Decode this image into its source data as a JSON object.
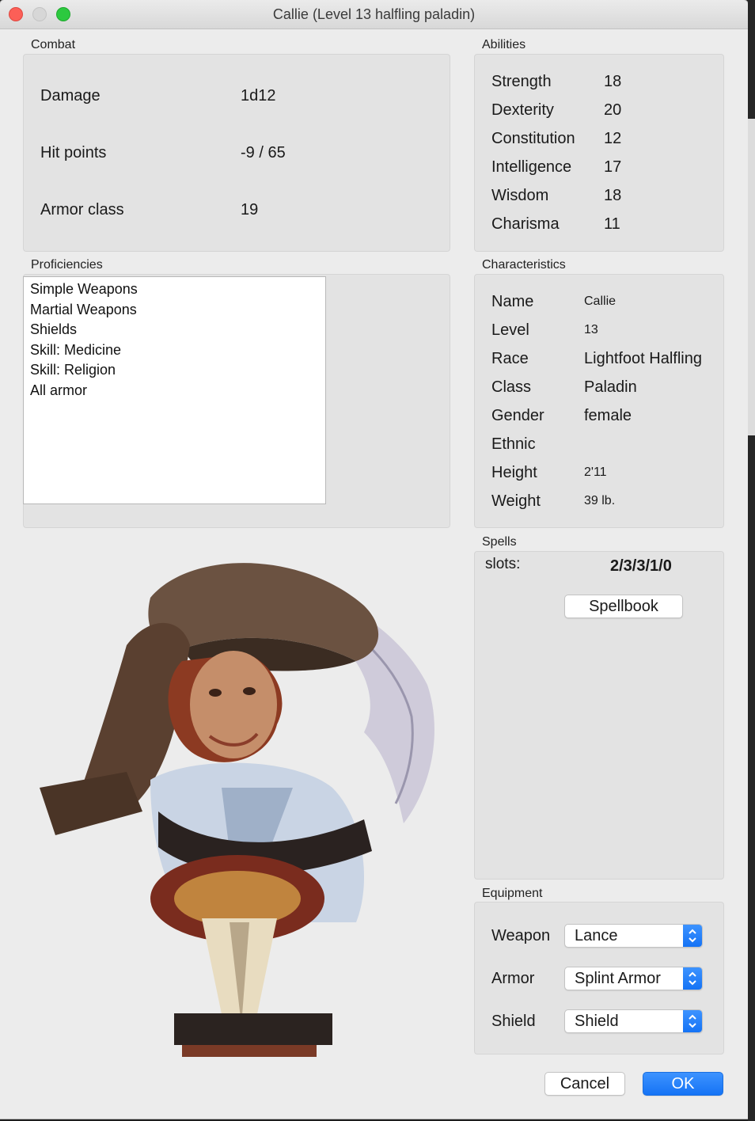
{
  "window": {
    "title": "Callie (Level 13 halfling paladin)"
  },
  "combat": {
    "label": "Combat",
    "rows": [
      {
        "label": "Damage",
        "value": "1d12"
      },
      {
        "label": "Hit points",
        "value": "-9 / 65"
      },
      {
        "label": "Armor class",
        "value": "19"
      }
    ]
  },
  "abilities": {
    "label": "Abilities",
    "rows": [
      {
        "label": "Strength",
        "value": "18"
      },
      {
        "label": "Dexterity",
        "value": "20"
      },
      {
        "label": "Constitution",
        "value": "12"
      },
      {
        "label": "Intelligence",
        "value": "17"
      },
      {
        "label": "Wisdom",
        "value": "18"
      },
      {
        "label": "Charisma",
        "value": "11"
      }
    ]
  },
  "proficiencies": {
    "label": "Proficiencies",
    "items": [
      "Simple Weapons",
      "Martial Weapons",
      "Shields",
      "Skill: Medicine",
      "Skill: Religion",
      "All armor"
    ]
  },
  "characteristics": {
    "label": "Characteristics",
    "rows": [
      {
        "label": "Name",
        "value": "Callie"
      },
      {
        "label": "Level",
        "value": "13"
      },
      {
        "label": "Race",
        "value": "Lightfoot Halfling"
      },
      {
        "label": "Class",
        "value": "Paladin"
      },
      {
        "label": "Gender",
        "value": "female"
      },
      {
        "label": "Ethnic",
        "value": ""
      },
      {
        "label": "Height",
        "value": "2'11"
      },
      {
        "label": "Weight",
        "value": "39 lb."
      }
    ]
  },
  "spells": {
    "label": "Spells",
    "slots_label": "slots:",
    "slots_value": "2/3/3/1/0",
    "spellbook_label": "Spellbook"
  },
  "equipment": {
    "label": "Equipment",
    "rows": [
      {
        "label": "Weapon",
        "value": "Lance"
      },
      {
        "label": "Armor",
        "value": "Splint Armor"
      },
      {
        "label": "Shield",
        "value": "Shield"
      }
    ]
  },
  "buttons": {
    "cancel": "Cancel",
    "ok": "OK"
  },
  "colors": {
    "accent": "#1573f5",
    "close": "#fc5f57",
    "maximize": "#2cc93f"
  }
}
